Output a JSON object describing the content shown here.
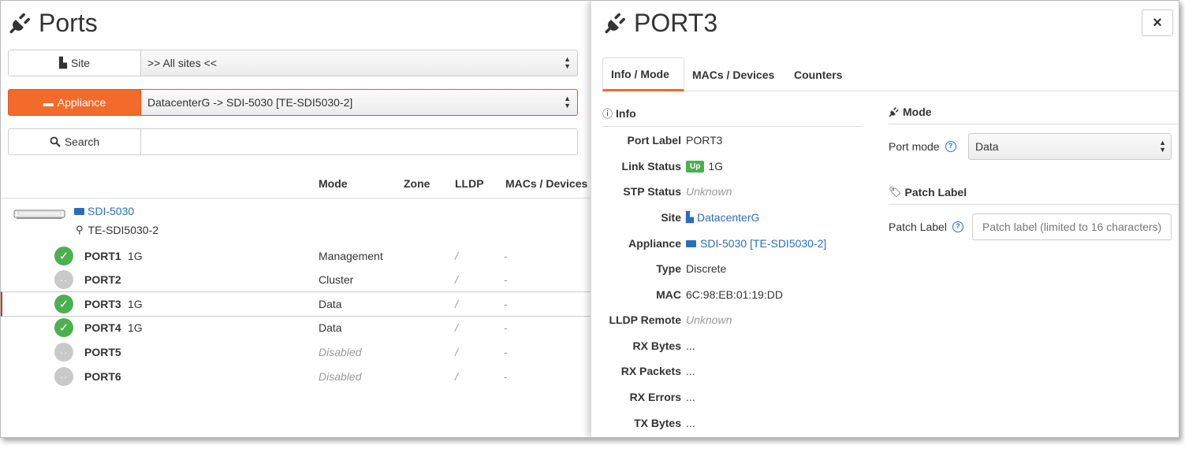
{
  "ports_panel": {
    "title": "Ports",
    "filters": {
      "site": {
        "label": "Site",
        "value": ">> All sites <<"
      },
      "appliance": {
        "label": "Appliance",
        "value": "DatacenterG -> SDI-5030 [TE-SDI5030-2]"
      },
      "search": {
        "label": "Search",
        "value": ""
      }
    },
    "columns": [
      "Mode",
      "Zone",
      "LLDP",
      "MACs / Devices"
    ],
    "device": {
      "name": "SDI-5030",
      "location": "TE-SDI5030-2"
    },
    "ports": [
      {
        "name": "PORT1",
        "speed": "1G",
        "mode": "Management",
        "lldp": "/",
        "macs": "-",
        "status": "up"
      },
      {
        "name": "PORT2",
        "speed": "",
        "mode": "Cluster",
        "lldp": "/",
        "macs": "-",
        "status": "down"
      },
      {
        "name": "PORT3",
        "speed": "1G",
        "mode": "Data",
        "lldp": "/",
        "macs": "-",
        "status": "up"
      },
      {
        "name": "PORT4",
        "speed": "1G",
        "mode": "Data",
        "lldp": "/",
        "macs": "-",
        "status": "up"
      },
      {
        "name": "PORT5",
        "speed": "",
        "mode": "Disabled",
        "lldp": "/",
        "macs": "-",
        "status": "down"
      },
      {
        "name": "PORT6",
        "speed": "",
        "mode": "Disabled",
        "lldp": "/",
        "macs": "-",
        "status": "down"
      }
    ]
  },
  "detail_panel": {
    "title": "PORT3",
    "close_label": "×",
    "tabs": [
      "Info / Mode",
      "MACs / Devices",
      "Counters"
    ],
    "info": {
      "heading": "Info",
      "rows": [
        {
          "label": "Port Label",
          "value": "PORT3"
        },
        {
          "label": "Link Status",
          "badge": "Up",
          "value": "1G"
        },
        {
          "label": "STP Status",
          "value": "Unknown"
        },
        {
          "label": "Site",
          "value": "DatacenterG"
        },
        {
          "label": "Appliance",
          "value": "SDI-5030 [TE-SDI5030-2]"
        },
        {
          "label": "Type",
          "value": "Discrete"
        },
        {
          "label": "MAC",
          "value": "6C:98:EB:01:19:DD"
        },
        {
          "label": "LLDP Remote",
          "value": "Unknown"
        },
        {
          "label": "RX Bytes",
          "value": "..."
        },
        {
          "label": "RX Packets",
          "value": "..."
        },
        {
          "label": "RX Errors",
          "value": "..."
        },
        {
          "label": "TX Bytes",
          "value": "..."
        }
      ]
    },
    "mode": {
      "heading": "Mode",
      "port_mode_label": "Port mode",
      "port_mode_value": "Data"
    },
    "patch": {
      "heading": "Patch Label",
      "label": "Patch Label",
      "placeholder": "Patch label (limited to 16 characters)"
    }
  },
  "colors": {
    "accent": "#f26b2a",
    "link": "#2a6ebb",
    "status_up": "#4caf50",
    "status_off": "#c9c9c9"
  }
}
